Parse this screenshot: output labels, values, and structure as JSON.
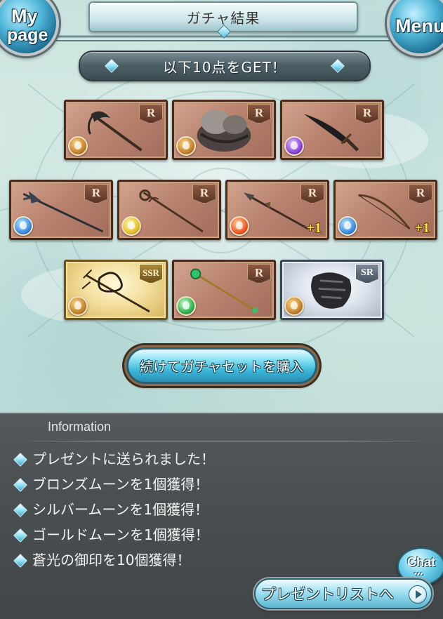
{
  "header": {
    "title": "ガチャ結果",
    "mypage_line1": "My",
    "mypage_line2": "page",
    "menu_label": "Menu"
  },
  "banner": {
    "text": "以下10点をGET！"
  },
  "cards": [
    {
      "rarity": "R",
      "element": "earth",
      "plus": "",
      "item_icon": "scythe-icon"
    },
    {
      "rarity": "R",
      "element": "earth",
      "plus": "",
      "item_icon": "beast-claw-icon"
    },
    {
      "rarity": "R",
      "element": "dark",
      "plus": "",
      "item_icon": "dagger-icon"
    },
    {
      "rarity": "R",
      "element": "water",
      "plus": "",
      "item_icon": "halberd-icon"
    },
    {
      "rarity": "R",
      "element": "light",
      "plus": "",
      "item_icon": "staff-icon"
    },
    {
      "rarity": "R",
      "element": "fire",
      "plus": "+1",
      "item_icon": "spear-icon"
    },
    {
      "rarity": "R",
      "element": "water",
      "plus": "+1",
      "item_icon": "bow-icon"
    },
    {
      "rarity": "SSR",
      "element": "earth",
      "plus": "",
      "item_icon": "thorn-staff-icon"
    },
    {
      "rarity": "R",
      "element": "wind",
      "plus": "",
      "item_icon": "emerald-staff-icon"
    },
    {
      "rarity": "SR",
      "element": "earth",
      "plus": "",
      "item_icon": "gauntlet-icon"
    }
  ],
  "continue_button": {
    "label": "続けてガチャセットを購入"
  },
  "information": {
    "header": "Information",
    "items": [
      "プレゼントに送られました！",
      "ブロンズムーンを1個獲得！",
      "シルバームーンを1個獲得！",
      "ゴールドムーンを1個獲得！",
      "蒼光の御印を10個獲得！"
    ]
  },
  "chat_button": {
    "label": "Chat",
    "dots": "•••"
  },
  "present_button": {
    "label": "プレゼントリストへ"
  },
  "colors": {
    "accent_cyan": "#3cb7d9",
    "card_r": "#b98370",
    "card_ssr": "#f3df9e",
    "card_sr": "#dfe6ef",
    "info_panel": "#4a5052"
  }
}
